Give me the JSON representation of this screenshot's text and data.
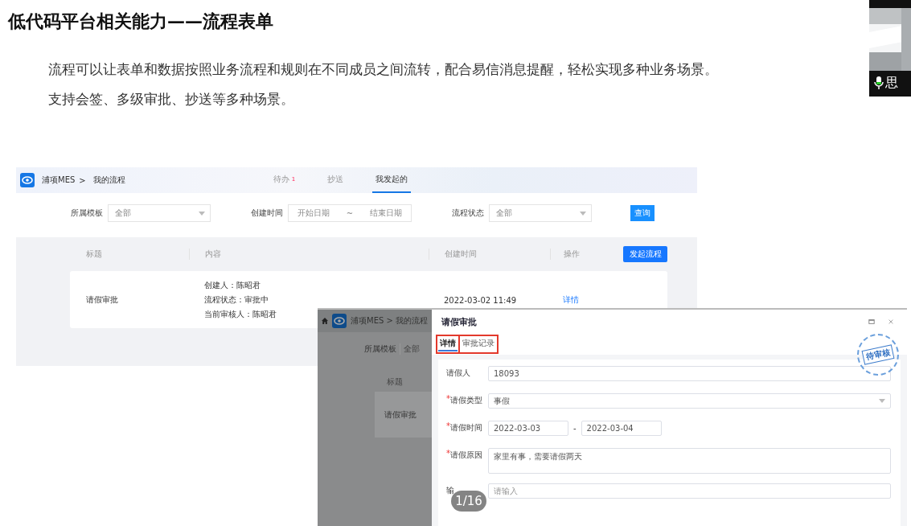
{
  "slide": {
    "title": "低代码平台相关能力——流程表单",
    "paragraphs": [
      "流程可以让表单和数据按照业务流程和规则在不同成员之间流转，配合易信消息提醒，轻松实现多种业务场景。",
      "支持会签、多级审批、抄送等多种场景。"
    ],
    "page_indicator": "1/16"
  },
  "list_screen": {
    "breadcrumb": {
      "app": "浦项MES",
      "separator": ">",
      "page": "我的流程"
    },
    "tabs": [
      {
        "label": "待办",
        "badge": "1",
        "selected": false
      },
      {
        "label": "抄送",
        "selected": false
      },
      {
        "label": "我发起的",
        "selected": true
      }
    ],
    "filters": {
      "template_label": "所属模板",
      "template_value": "全部",
      "time_label": "创建时间",
      "start_placeholder": "开始日期",
      "separator": "~",
      "end_placeholder": "结束日期",
      "status_label": "流程状态",
      "status_value": "全部",
      "search_button": "查询"
    },
    "table": {
      "columns": [
        "标题",
        "内容",
        "创建时间",
        "操作"
      ],
      "new_button": "发起流程",
      "rows": [
        {
          "title": "请假审批",
          "content": [
            "创建人：陈昭君",
            "流程状态：审批中",
            "当前审核人：陈昭君"
          ],
          "created": "2022-03-02 11:49",
          "action": "详情"
        }
      ]
    }
  },
  "detail_screen": {
    "background": {
      "breadcrumb_app": "浦项MES",
      "separator": ">",
      "breadcrumb_page": "我的流程",
      "filter_label": "所属模板",
      "filter_value": "全部",
      "column": "标题",
      "row_title": "请假审批"
    },
    "dialog": {
      "title": "请假审批",
      "tabs": [
        {
          "label": "详情",
          "selected": true,
          "annotated": true
        },
        {
          "label": "审批记录",
          "selected": false,
          "annotated": true
        }
      ],
      "stamp": "待审核",
      "fields": [
        {
          "kind": "text",
          "label": "请假人",
          "value": "18093"
        },
        {
          "kind": "select",
          "required_mark": "*",
          "label": "请假类型",
          "value": "事假"
        },
        {
          "kind": "range",
          "required_mark": "*",
          "label": "请假时间",
          "start": "2022-03-03",
          "separator": "-",
          "end": "2022-03-04"
        },
        {
          "kind": "textarea",
          "required_mark": "*",
          "label": "请假原因",
          "value": "家里有事，需要请假两天"
        },
        {
          "kind": "text",
          "label": "输",
          "placeholder": "请输入"
        }
      ]
    }
  },
  "webcam": {
    "caption": "思"
  }
}
